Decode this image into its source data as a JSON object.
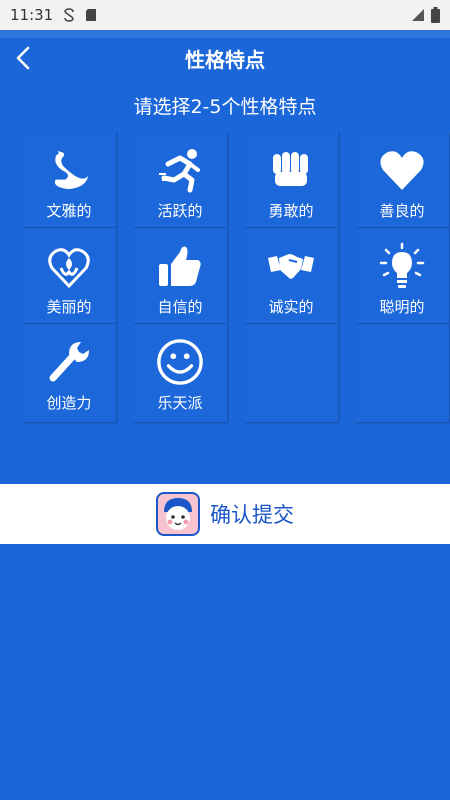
{
  "status": {
    "time": "11:31"
  },
  "header": {
    "title": "性格特点",
    "subtitle": "请选择2-5个性格特点"
  },
  "traits": [
    {
      "label": "文雅的",
      "icon": "swan-icon"
    },
    {
      "label": "活跃的",
      "icon": "runner-icon"
    },
    {
      "label": "勇敢的",
      "icon": "fist-icon"
    },
    {
      "label": "善良的",
      "icon": "heart-icon"
    },
    {
      "label": "美丽的",
      "icon": "flower-heart-icon"
    },
    {
      "label": "自信的",
      "icon": "thumbs-up-icon"
    },
    {
      "label": "诚实的",
      "icon": "handshake-icon"
    },
    {
      "label": "聪明的",
      "icon": "lightbulb-icon"
    },
    {
      "label": "创造力",
      "icon": "wrench-icon"
    },
    {
      "label": "乐天派",
      "icon": "smiley-icon"
    }
  ],
  "submit": {
    "label": "确认提交"
  },
  "colors": {
    "background": "#1b67d9",
    "accent": "#1b56c8"
  }
}
